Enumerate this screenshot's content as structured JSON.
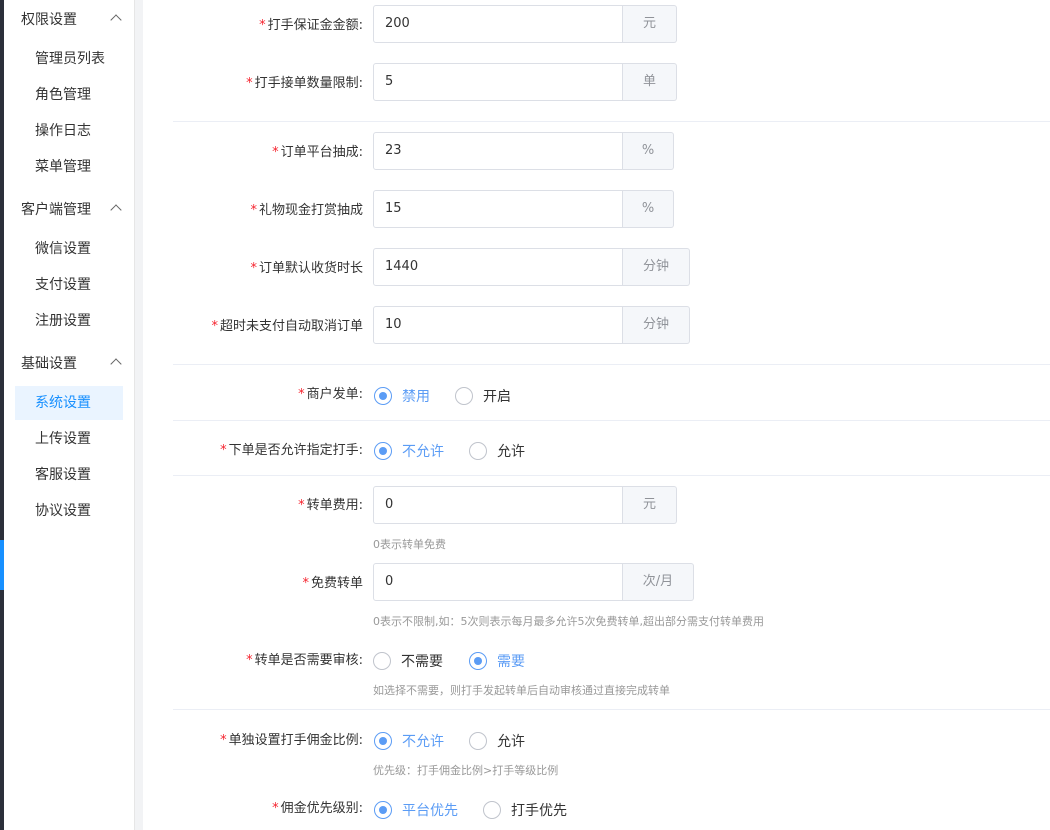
{
  "sidebar": {
    "groups": [
      {
        "title": "权限设置",
        "items": [
          "管理员列表",
          "角色管理",
          "操作日志",
          "菜单管理"
        ]
      },
      {
        "title": "客户端管理",
        "items": [
          "微信设置",
          "支付设置",
          "注册设置"
        ]
      },
      {
        "title": "基础设置",
        "items": [
          "系统设置",
          "上传设置",
          "客服设置",
          "协议设置"
        ]
      }
    ],
    "active_item": "系统设置"
  },
  "form": {
    "deposit": {
      "label": "打手保证金金额:",
      "value": "200",
      "suffix": "元"
    },
    "order_limit": {
      "label": "打手接单数量限制:",
      "value": "5",
      "suffix": "单"
    },
    "platform_commission": {
      "label": "订单平台抽成:",
      "value": "23",
      "suffix": "%"
    },
    "gift_commission": {
      "label": "礼物现金打赏抽成",
      "value": "15",
      "suffix": "%"
    },
    "auto_receive": {
      "label": "订单默认收货时长",
      "value": "1440",
      "suffix": "分钟"
    },
    "auto_cancel": {
      "label": "超时未支付自动取消订单",
      "value": "10",
      "suffix": "分钟"
    },
    "merchant_publish": {
      "label": "商户发单:",
      "options": [
        "禁用",
        "开启"
      ],
      "selected": "禁用"
    },
    "assign_player": {
      "label": "下单是否允许指定打手:",
      "options": [
        "不允许",
        "允许"
      ],
      "selected": "不允许"
    },
    "transfer_fee": {
      "label": "转单费用:",
      "value": "0",
      "suffix": "元",
      "hint": "0表示转单免费"
    },
    "free_transfer": {
      "label": "免费转单",
      "value": "0",
      "suffix": "次/月",
      "hint": "0表示不限制,如：5次则表示每月最多允许5次免费转单,超出部分需支付转单费用"
    },
    "transfer_review": {
      "label": "转单是否需要审核:",
      "options": [
        "不需要",
        "需要"
      ],
      "selected": "需要",
      "hint": "如选择不需要，则打手发起转单后自动审核通过直接完成转单"
    },
    "individual_ratio": {
      "label": "单独设置打手佣金比例:",
      "options": [
        "不允许",
        "允许"
      ],
      "selected": "不允许",
      "hint": "优先级：打手佣金比例>打手等级比例"
    },
    "commission_priority": {
      "label": "佣金优先级别:",
      "options": [
        "平台优先",
        "打手优先"
      ],
      "selected": "平台优先"
    }
  }
}
